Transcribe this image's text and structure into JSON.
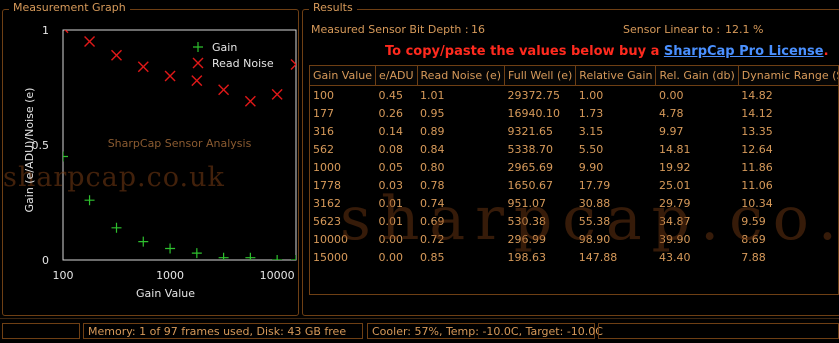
{
  "graph_panel": {
    "title": "Measurement Graph",
    "watermark": "SharpCap Sensor Analysis",
    "site_watermark": "sharpcap.co.uk",
    "ylabel": "Gain (e/ADU)/Noise (e)",
    "xlabel": "Gain Value",
    "y_ticks": [
      "1",
      "0.5",
      "0"
    ],
    "x_ticks": [
      "100",
      "1000",
      "10000"
    ],
    "legend": {
      "gain_label": "Gain",
      "noise_label": "Read Noise",
      "gain_marker": "+",
      "noise_marker": "✕"
    }
  },
  "chart_data": {
    "type": "scatter",
    "xscale": "log",
    "xlim": [
      100,
      15000
    ],
    "ylim": [
      0,
      1
    ],
    "grid": false,
    "legend_position": "top-right",
    "xlabel": "Gain Value",
    "ylabel": "Gain (e/ADU)/Noise (e)",
    "x": [
      100,
      177,
      316,
      562,
      1000,
      1778,
      3162,
      5623,
      10000,
      15000
    ],
    "series": [
      {
        "name": "Gain",
        "color": "#2ec02e",
        "values": [
          0.45,
          0.26,
          0.14,
          0.08,
          0.05,
          0.03,
          0.01,
          0.01,
          0.0,
          0.0
        ]
      },
      {
        "name": "Read Noise",
        "color": "#e01818",
        "values": [
          1.01,
          0.95,
          0.89,
          0.84,
          0.8,
          0.78,
          0.74,
          0.69,
          0.72,
          0.85
        ]
      }
    ]
  },
  "results_panel": {
    "title": "Results",
    "bit_depth_label": "Measured Sensor Bit Depth :",
    "bit_depth_value": "16",
    "linear_label": "Sensor Linear to :",
    "linear_value": "12.1 %",
    "buy_text": "To copy/paste the values below buy a ",
    "buy_link": "SharpCap Pro License",
    "buy_suffix": ".",
    "watermark": "sharpcap.co.u",
    "columns": [
      "Gain Value",
      "e/ADU",
      "Read Noise (e)",
      "Full Well (e)",
      "Relative Gain",
      "Rel. Gain (db)",
      "Dynamic Range (Stops)"
    ],
    "rows": [
      [
        "100",
        "0.45",
        "1.01",
        "29372.75",
        "1.00",
        "0.00",
        "14.82"
      ],
      [
        "177",
        "0.26",
        "0.95",
        "16940.10",
        "1.73",
        "4.78",
        "14.12"
      ],
      [
        "316",
        "0.14",
        "0.89",
        "9321.65",
        "3.15",
        "9.97",
        "13.35"
      ],
      [
        "562",
        "0.08",
        "0.84",
        "5338.70",
        "5.50",
        "14.81",
        "12.64"
      ],
      [
        "1000",
        "0.05",
        "0.80",
        "2965.69",
        "9.90",
        "19.92",
        "11.86"
      ],
      [
        "1778",
        "0.03",
        "0.78",
        "1650.67",
        "17.79",
        "25.01",
        "11.06"
      ],
      [
        "3162",
        "0.01",
        "0.74",
        "951.07",
        "30.88",
        "29.79",
        "10.34"
      ],
      [
        "5623",
        "0.01",
        "0.69",
        "530.38",
        "55.38",
        "34.87",
        "9.59"
      ],
      [
        "10000",
        "0.00",
        "0.72",
        "296.99",
        "98.90",
        "39.90",
        "8.69"
      ],
      [
        "15000",
        "0.00",
        "0.85",
        "198.63",
        "147.88",
        "43.40",
        "7.88"
      ]
    ]
  },
  "status_bar": {
    "memory": "Memory: 1 of 97 frames used, Disk: 43 GB free",
    "cooler": "Cooler: 57%, Temp: -10.0C, Target: -10.0C"
  }
}
